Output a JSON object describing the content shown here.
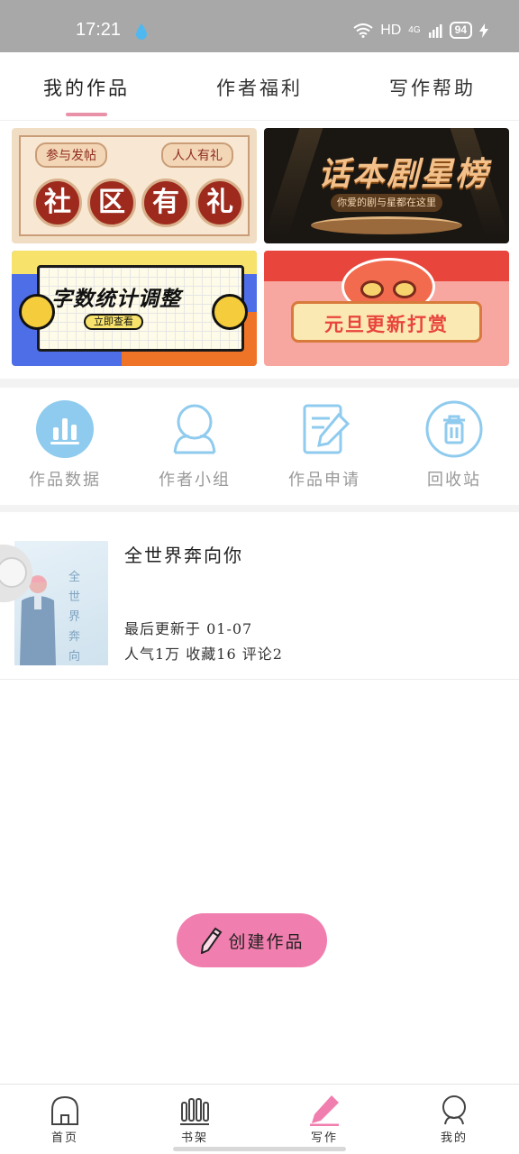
{
  "status_bar": {
    "time": "17:21",
    "network": "HD",
    "signal": "4G",
    "battery": "94"
  },
  "tabs": [
    {
      "label": "我的作品",
      "active": true
    },
    {
      "label": "作者福利",
      "active": false
    },
    {
      "label": "写作帮助",
      "active": false
    }
  ],
  "banners": {
    "community": {
      "tag_left": "参与发帖",
      "tag_right": "人人有礼",
      "chars": [
        "社",
        "区",
        "有",
        "礼"
      ]
    },
    "star": {
      "title": "话本剧星榜",
      "subtitle": "你爱的剧与星都在这里"
    },
    "wordcount": {
      "title": "字数统计调整",
      "button": "立即查看"
    },
    "newyear": {
      "title": "元旦更新打赏"
    }
  },
  "actions": [
    {
      "label": "作品数据",
      "icon": "bar-chart-icon"
    },
    {
      "label": "作者小组",
      "icon": "group-icon"
    },
    {
      "label": "作品申请",
      "icon": "edit-form-icon"
    },
    {
      "label": "回收站",
      "icon": "trash-icon"
    }
  ],
  "work": {
    "title": "全世界奔向你",
    "cover_text": "全世界奔向你",
    "updated": "最后更新于 01-07",
    "stats": "人气1万 收藏16 评论2"
  },
  "create_button": {
    "label": "创建作品"
  },
  "bottom_nav": [
    {
      "label": "首页",
      "icon": "home-icon",
      "active": false
    },
    {
      "label": "书架",
      "icon": "bookshelf-icon",
      "active": false
    },
    {
      "label": "写作",
      "icon": "pen-icon",
      "active": true
    },
    {
      "label": "我的",
      "icon": "profile-icon",
      "active": false
    }
  ],
  "colors": {
    "accent_pink": "#f07eae",
    "tab_underline": "#e891a9",
    "icon_blue": "#8fcbee"
  }
}
